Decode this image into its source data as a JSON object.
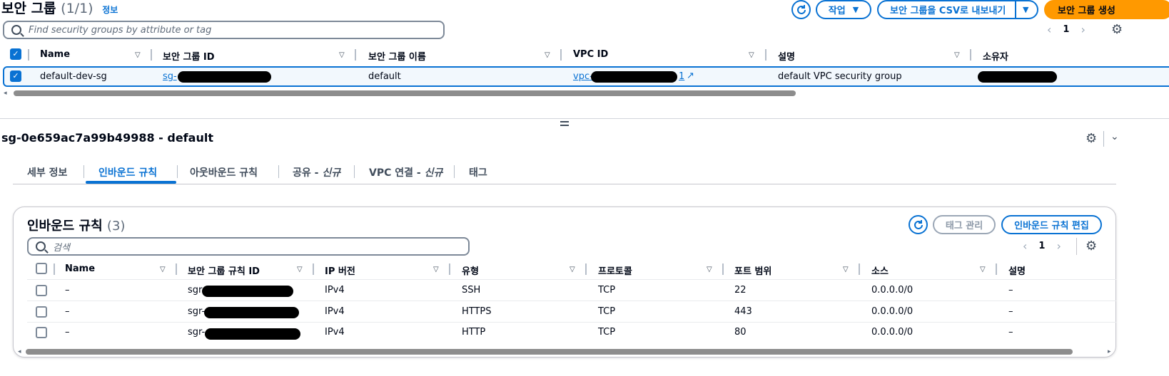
{
  "header": {
    "title": "보안 그룹",
    "count": "(1/1)",
    "info": "정보",
    "actions_label": "작업",
    "export_label": "보안 그룹을 CSV로 내보내기",
    "create_label": "보안 그룹 생성"
  },
  "top_search": {
    "placeholder": "Find security groups by attribute or tag"
  },
  "top_pager": {
    "page": "1"
  },
  "top_table": {
    "columns": [
      "Name",
      "보안 그룹 ID",
      "보안 그룹 이름",
      "VPC ID",
      "설명",
      "소유자"
    ],
    "row": {
      "name": "default-dev-sg",
      "sg_id_prefix": "sg-",
      "sg_name": "default",
      "vpc_prefix": "vpc-",
      "vpc_suffix": "1",
      "description": "default VPC security group"
    }
  },
  "detail": {
    "title": "sg-0e659ac7a99b49988 - default",
    "tabs": [
      "세부 정보",
      "인바운드 규칙",
      "아웃바운드 규칙",
      "공유 - ",
      "VPC 연결 - ",
      "태그"
    ],
    "tab_new": "신규"
  },
  "inbound": {
    "title": "인바운드 규칙",
    "count": "(3)",
    "manage_tags_label": "태그 관리",
    "edit_label": "인바운드 규칙 편집",
    "search_placeholder": "검색",
    "page": "1",
    "columns": [
      "Name",
      "보안 그룹 규칙 ID",
      "IP 버전",
      "유형",
      "프로토콜",
      "포트 범위",
      "소스",
      "설명"
    ],
    "rows": [
      {
        "name": "–",
        "rule_id_prefix": "sgr",
        "ip_version": "IPv4",
        "type": "SSH",
        "protocol": "TCP",
        "port": "22",
        "source": "0.0.0.0/0",
        "description": "–"
      },
      {
        "name": "–",
        "rule_id_prefix": "sgr-",
        "ip_version": "IPv4",
        "type": "HTTPS",
        "protocol": "TCP",
        "port": "443",
        "source": "0.0.0.0/0",
        "description": "–"
      },
      {
        "name": "–",
        "rule_id_prefix": "sgr-",
        "ip_version": "IPv4",
        "type": "HTTP",
        "protocol": "TCP",
        "port": "80",
        "source": "0.0.0.0/0",
        "description": "–"
      }
    ]
  },
  "icons": {
    "refresh": "refresh-icon",
    "caret": "caret-down-icon",
    "gear": "gear-icon",
    "search": "search-icon",
    "external": "external-link-icon",
    "chevron_left": "chevron-left-icon",
    "chevron_right": "chevron-right-icon"
  },
  "colors": {
    "accent": "#0972d3",
    "primary_button": "#ff9900",
    "text": "#000716"
  }
}
